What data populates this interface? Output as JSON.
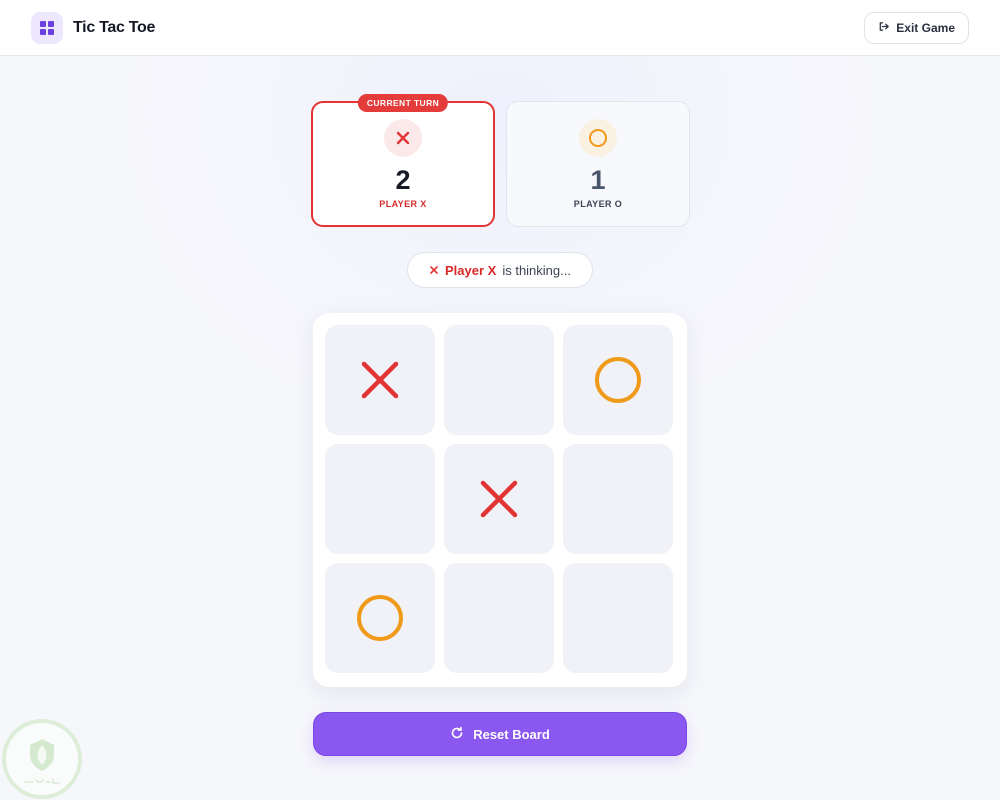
{
  "app": {
    "title": "Tic Tac Toe",
    "exit_label": "Exit Game"
  },
  "players": [
    {
      "symbol": "X",
      "score": "2",
      "label": "PLAYER X",
      "badge": "CURRENT TURN",
      "active": true
    },
    {
      "symbol": "O",
      "score": "1",
      "label": "PLAYER O",
      "active": false
    }
  ],
  "status": {
    "player": "Player X",
    "text": "is thinking..."
  },
  "board": [
    "X",
    "",
    "O",
    "",
    "X",
    "",
    "O",
    "",
    ""
  ],
  "reset_label": "Reset Board",
  "colors": {
    "x": "#e23434",
    "o": "#f09a1a",
    "accent": "#8a58f0",
    "cell": "#f0f2f7"
  },
  "icons": {
    "brand": "grid-icon",
    "exit": "exit-icon",
    "reset": "refresh-icon"
  }
}
